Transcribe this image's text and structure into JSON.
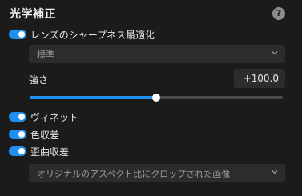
{
  "panel": {
    "title": "光学補正",
    "help_glyph": "?"
  },
  "lens_correction": {
    "label": "レンズのシャープネス最適化",
    "enabled": true,
    "preset_value": "標準"
  },
  "strength": {
    "label": "強さ",
    "value_text": "+100.0",
    "slider_fraction": 0.5
  },
  "vignette": {
    "label": "ヴィネット",
    "enabled": true
  },
  "chromatic_aberration": {
    "label": "色収差",
    "enabled": true
  },
  "distortion": {
    "label": "歪曲収差",
    "enabled": true,
    "mode_value": "オリジナルのアスペクト比にクロップされた画像"
  },
  "colors": {
    "accent": "#1f8ff0",
    "background": "#1b1b1b",
    "field": "#2c2c2c"
  }
}
